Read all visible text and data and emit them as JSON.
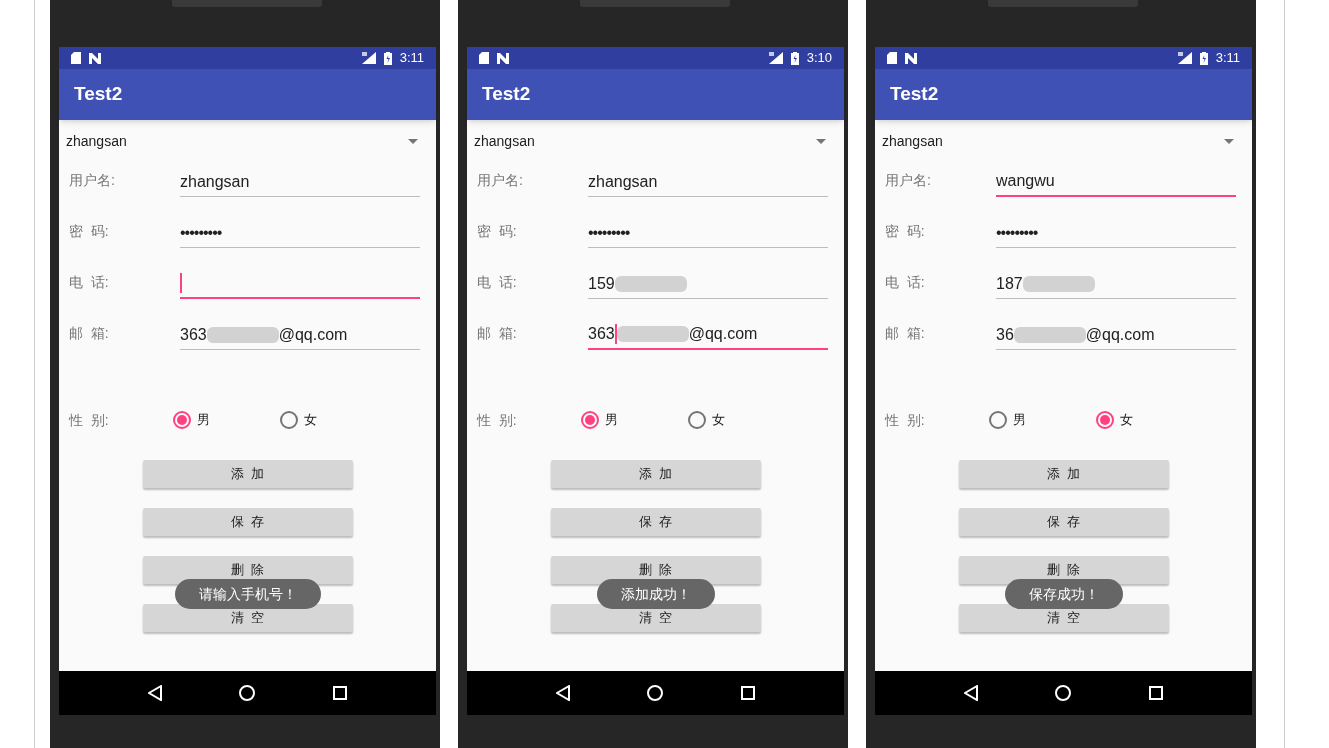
{
  "phones": [
    {
      "status_bar": {
        "time": "3:11"
      },
      "app_bar": {
        "title": "Test2"
      },
      "spinner": {
        "value": "zhangsan"
      },
      "fields": [
        {
          "kind": "text",
          "label": "用户名:",
          "value": "zhangsan",
          "focused": false,
          "cursor": false
        },
        {
          "kind": "password",
          "label": "密  码:",
          "value": "•••••••••",
          "focused": false,
          "cursor": false
        },
        {
          "kind": "text",
          "label": "电  话:",
          "focused": true,
          "cursor": true
        },
        {
          "kind": "text",
          "label": "邮  箱:",
          "value": "363",
          "redacted": true,
          "suffix": "@qq.com",
          "focused": false,
          "cursor": false
        }
      ],
      "gender": {
        "label": "性  别:",
        "options": [
          {
            "label": "男",
            "selected": true
          },
          {
            "label": "女",
            "selected": false
          }
        ]
      },
      "buttons": [
        "添  加",
        "保  存",
        "删  除",
        "清  空"
      ],
      "toast": "请输入手机号！"
    },
    {
      "status_bar": {
        "time": "3:10"
      },
      "app_bar": {
        "title": "Test2"
      },
      "spinner": {
        "value": "zhangsan"
      },
      "fields": [
        {
          "kind": "text",
          "label": "用户名:",
          "value": "zhangsan",
          "focused": false,
          "cursor": false
        },
        {
          "kind": "password",
          "label": "密  码:",
          "value": "•••••••••",
          "focused": false,
          "cursor": false
        },
        {
          "kind": "text",
          "label": "电  话:",
          "value": "159",
          "redacted": true,
          "focused": false,
          "cursor": false
        },
        {
          "kind": "text",
          "label": "邮  箱:",
          "value": "363",
          "redacted": true,
          "suffix": "@qq.com",
          "focused": true,
          "cursor": true
        }
      ],
      "gender": {
        "label": "性  别:",
        "options": [
          {
            "label": "男",
            "selected": true
          },
          {
            "label": "女",
            "selected": false
          }
        ]
      },
      "buttons": [
        "添  加",
        "保  存",
        "删  除",
        "清  空"
      ],
      "toast": "添加成功！"
    },
    {
      "status_bar": {
        "time": "3:11"
      },
      "app_bar": {
        "title": "Test2"
      },
      "spinner": {
        "value": "zhangsan"
      },
      "fields": [
        {
          "kind": "text",
          "label": "用户名:",
          "value": "wangwu",
          "focused": true,
          "cursor": false
        },
        {
          "kind": "password",
          "label": "密  码:",
          "value": "•••••••••",
          "focused": false,
          "cursor": false
        },
        {
          "kind": "text",
          "label": "电  话:",
          "value": "187",
          "redacted": true,
          "focused": false,
          "cursor": false
        },
        {
          "kind": "text",
          "label": "邮  箱:",
          "value": "36",
          "redacted": true,
          "suffix": "@qq.com",
          "focused": false,
          "cursor": false
        }
      ],
      "gender": {
        "label": "性  别:",
        "options": [
          {
            "label": "男",
            "selected": false
          },
          {
            "label": "女",
            "selected": true
          }
        ]
      },
      "buttons": [
        "添  加",
        "保  存",
        "删  除",
        "清  空"
      ],
      "toast": "保存成功！"
    }
  ]
}
